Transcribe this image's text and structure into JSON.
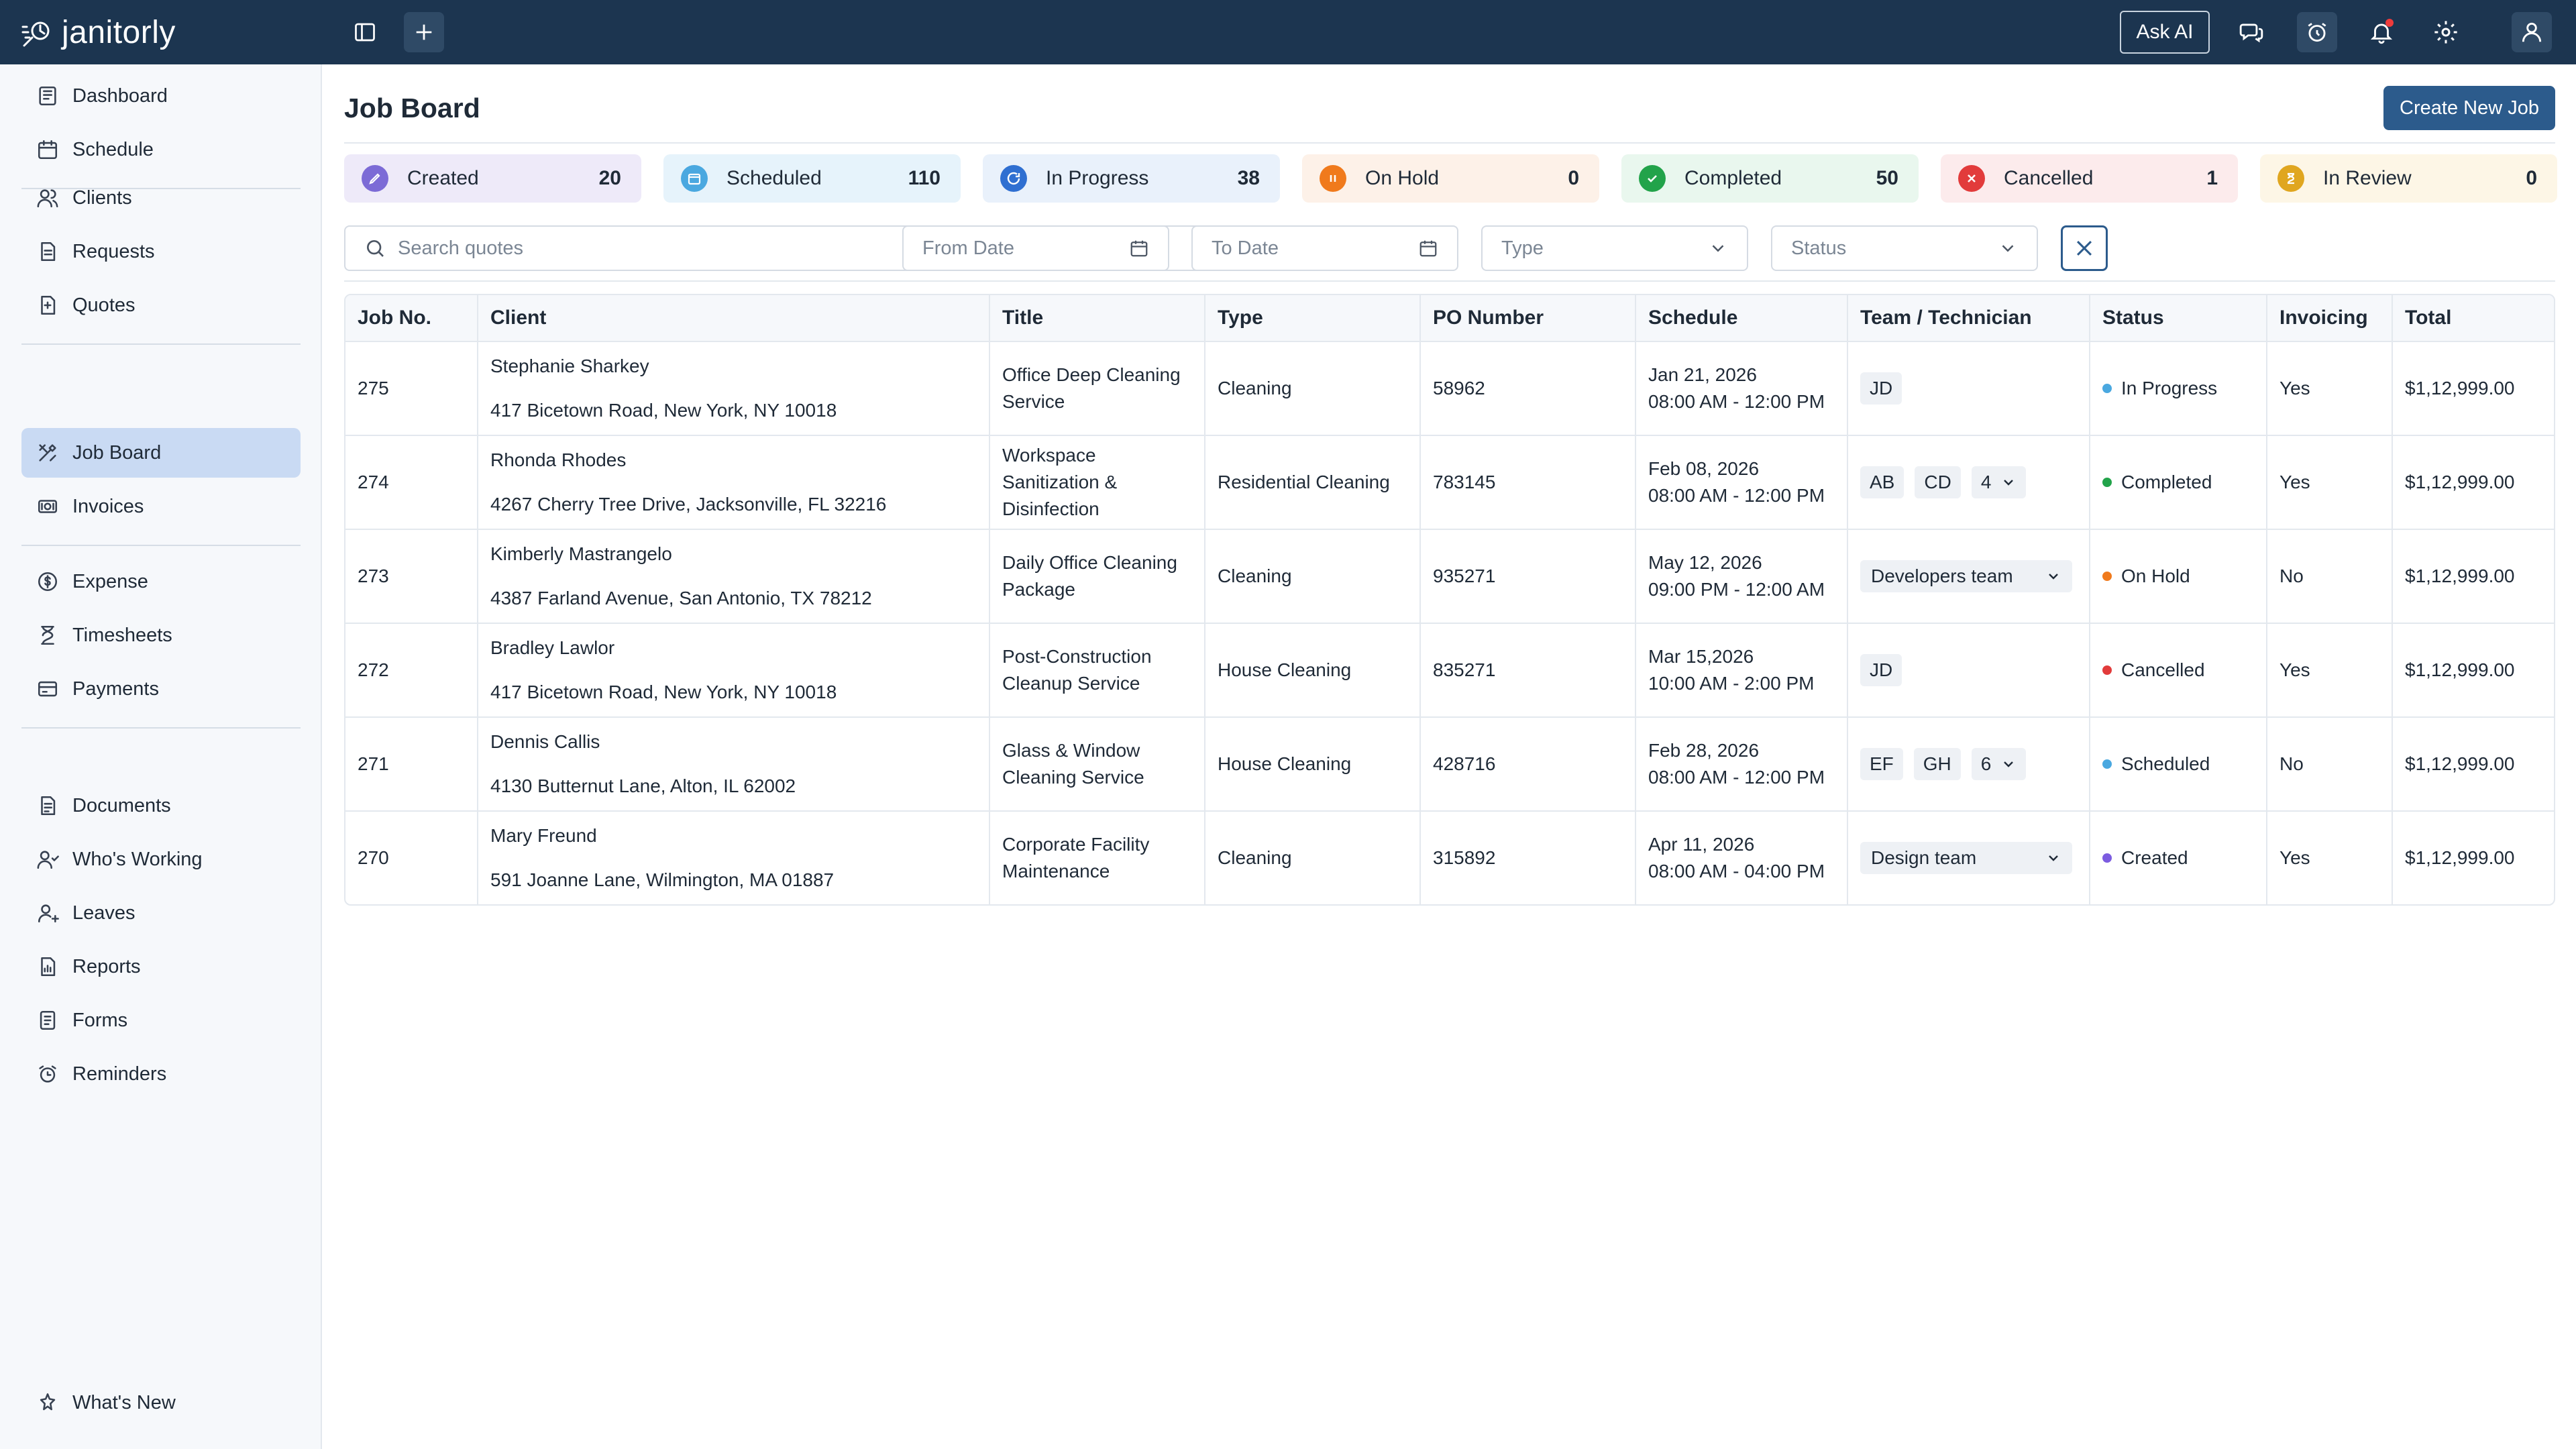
{
  "brand": {
    "logo_text": "janitorly"
  },
  "topbar": {
    "ask_ai": "Ask AI"
  },
  "sidebar": {
    "groups": [
      [
        {
          "label": "Dashboard",
          "icon": "dashboard-icon"
        },
        {
          "label": "Schedule",
          "icon": "calendar-icon"
        }
      ],
      [
        {
          "label": "Clients",
          "icon": "users-icon"
        },
        {
          "label": "Requests",
          "icon": "file-icon"
        },
        {
          "label": "Quotes",
          "icon": "quote-icon"
        }
      ],
      [
        {
          "label": "Job Board",
          "icon": "tools-icon",
          "active": true
        },
        {
          "label": "Invoices",
          "icon": "dollar-icon"
        }
      ],
      [
        {
          "label": "Expense",
          "icon": "coin-icon"
        },
        {
          "label": "Timesheets",
          "icon": "hourglass-icon"
        },
        {
          "label": "Payments",
          "icon": "credit-card-icon"
        }
      ],
      [
        {
          "label": "Documents",
          "icon": "document-icon"
        },
        {
          "label": "Who's Working",
          "icon": "team-icon"
        },
        {
          "label": "Leaves",
          "icon": "user-leave-icon"
        },
        {
          "label": "Reports",
          "icon": "report-icon"
        },
        {
          "label": "Forms",
          "icon": "form-icon"
        },
        {
          "label": "Reminders",
          "icon": "alarm-icon"
        }
      ]
    ],
    "bottom": {
      "label": "What's New",
      "icon": "sparkle-icon"
    }
  },
  "page": {
    "title": "Job Board",
    "create_button": "Create New Job"
  },
  "stats": [
    {
      "label": "Created",
      "count": "20",
      "bg": "#eeeaf9",
      "icon_color": "#7c6bd6"
    },
    {
      "label": "Scheduled",
      "count": "110",
      "bg": "#e6f3fb",
      "icon_color": "#4aa8e0"
    },
    {
      "label": "In Progress",
      "count": "38",
      "bg": "#e9f1fb",
      "icon_color": "#2f6fd1"
    },
    {
      "label": "On Hold",
      "count": "0",
      "bg": "#fdf1e8",
      "icon_color": "#f07a1c"
    },
    {
      "label": "Completed",
      "count": "50",
      "bg": "#e9f7ee",
      "icon_color": "#22a34a"
    },
    {
      "label": "Cancelled",
      "count": "1",
      "bg": "#fcebec",
      "icon_color": "#e23b3b"
    },
    {
      "label": "In Review",
      "count": "0",
      "bg": "#fdf6e6",
      "icon_color": "#e0a61f"
    }
  ],
  "filters": {
    "search_placeholder": "Search quotes",
    "from_date": "From Date",
    "to_date": "To Date",
    "type": "Type",
    "status": "Status"
  },
  "table": {
    "headers": [
      "Job No.",
      "Client",
      "Title",
      "Type",
      "PO Number",
      "Schedule",
      "Team / Technician",
      "Status",
      "Invoicing",
      "Total"
    ],
    "rows": [
      {
        "job": "275",
        "client_name": "Stephanie Sharkey",
        "client_address": "417 Bicetown Road, New York, NY 10018",
        "title": [
          "Office Deep Cleaning",
          "Service"
        ],
        "type": "Cleaning",
        "po": "58962",
        "date": "Jan 21, 2026",
        "time": "08:00 AM - 12:00 PM",
        "team": {
          "chips": [
            "JD"
          ]
        },
        "status": "In Progress",
        "status_color": "#4aa8e0",
        "invoicing": "Yes",
        "total": "$1,12,999.00"
      },
      {
        "job": "274",
        "client_name": "Rhonda Rhodes",
        "client_address": "4267 Cherry Tree Drive, Jacksonville, FL 32216",
        "title": [
          "Workspace",
          "Sanitization &",
          "Disinfection"
        ],
        "type": "Residential Cleaning",
        "po": "783145",
        "date": "Feb 08, 2026",
        "time": "08:00 AM - 12:00 PM",
        "team": {
          "chips": [
            "AB",
            "CD"
          ],
          "more": "4"
        },
        "status": "Completed",
        "status_color": "#22a34a",
        "invoicing": "Yes",
        "total": "$1,12,999.00"
      },
      {
        "job": "273",
        "client_name": "Kimberly Mastrangelo",
        "client_address": "4387 Farland Avenue, San Antonio, TX 78212",
        "title": [
          "Daily Office Cleaning",
          "Package"
        ],
        "type": "Cleaning",
        "po": "935271",
        "date": "May 12, 2026",
        "time": "09:00 PM - 12:00 AM",
        "team": {
          "team": "Developers team"
        },
        "status": "On Hold",
        "status_color": "#f07a1c",
        "invoicing": "No",
        "total": "$1,12,999.00"
      },
      {
        "job": "272",
        "client_name": "Bradley Lawlor",
        "client_address": "417 Bicetown Road, New York, NY 10018",
        "title": [
          "Post-Construction",
          "Cleanup Service"
        ],
        "type": "House Cleaning",
        "po": "835271",
        "date": "Mar 15,2026",
        "time": "10:00 AM - 2:00 PM",
        "team": {
          "chips": [
            "JD"
          ]
        },
        "status": "Cancelled",
        "status_color": "#e23b3b",
        "invoicing": "Yes",
        "total": "$1,12,999.00"
      },
      {
        "job": "271",
        "client_name": "Dennis Callis",
        "client_address": "4130 Butternut Lane, Alton, IL 62002",
        "title": [
          "Glass & Window",
          "Cleaning Service"
        ],
        "type": "House Cleaning",
        "po": "428716",
        "date": "Feb 28, 2026",
        "time": "08:00 AM - 12:00 PM",
        "team": {
          "chips": [
            "EF",
            "GH"
          ],
          "more": "6"
        },
        "status": "Scheduled",
        "status_color": "#4aa8e0",
        "invoicing": "No",
        "total": "$1,12,999.00"
      },
      {
        "job": "270",
        "client_name": "Mary Freund",
        "client_address": "591 Joanne Lane, Wilmington, MA 01887",
        "title": [
          "Corporate Facility",
          "Maintenance"
        ],
        "type": "Cleaning",
        "po": "315892",
        "date": "Apr 11, 2026",
        "time": "08:00 AM - 04:00 PM",
        "team": {
          "team": "Design team"
        },
        "status": "Created",
        "status_color": "#7c5ce0",
        "invoicing": "Yes",
        "total": "$1,12,999.00"
      }
    ]
  }
}
